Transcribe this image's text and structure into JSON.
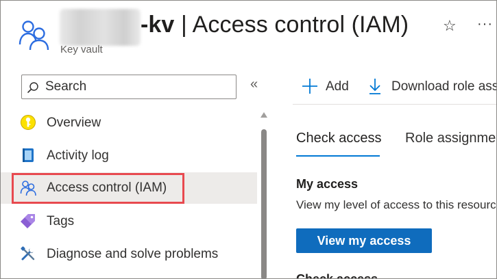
{
  "header": {
    "title_suffix": "-kv",
    "title_separator": " | ",
    "title_main": "Access control (IAM)",
    "subtitle": "Key vault",
    "favorite_icon": "star-icon",
    "more_icon": "more-icon",
    "more_glyph": "···"
  },
  "sidebar": {
    "search": {
      "placeholder": "Search",
      "value": ""
    },
    "collapse_glyph": "«",
    "items": [
      {
        "label": "Overview",
        "icon": "overview-icon"
      },
      {
        "label": "Activity log",
        "icon": "activity-log-icon"
      },
      {
        "label": "Access control (IAM)",
        "icon": "access-control-icon",
        "selected": true
      },
      {
        "label": "Tags",
        "icon": "tags-icon"
      },
      {
        "label": "Diagnose and solve problems",
        "icon": "diagnose-icon"
      }
    ]
  },
  "toolbar": {
    "add_label": "Add",
    "download_label": "Download role assignments"
  },
  "tabs": [
    {
      "label": "Check access",
      "active": true
    },
    {
      "label": "Role assignments",
      "active": false
    }
  ],
  "my_access": {
    "title": "My access",
    "description": "View my level of access to this resource.",
    "button_label": "View my access",
    "next_section_title": "Check access"
  },
  "colors": {
    "accent": "#0078d4",
    "primary_button": "#0f6cbd",
    "highlight": "#e8494f",
    "selected_bg": "#edebe9"
  }
}
